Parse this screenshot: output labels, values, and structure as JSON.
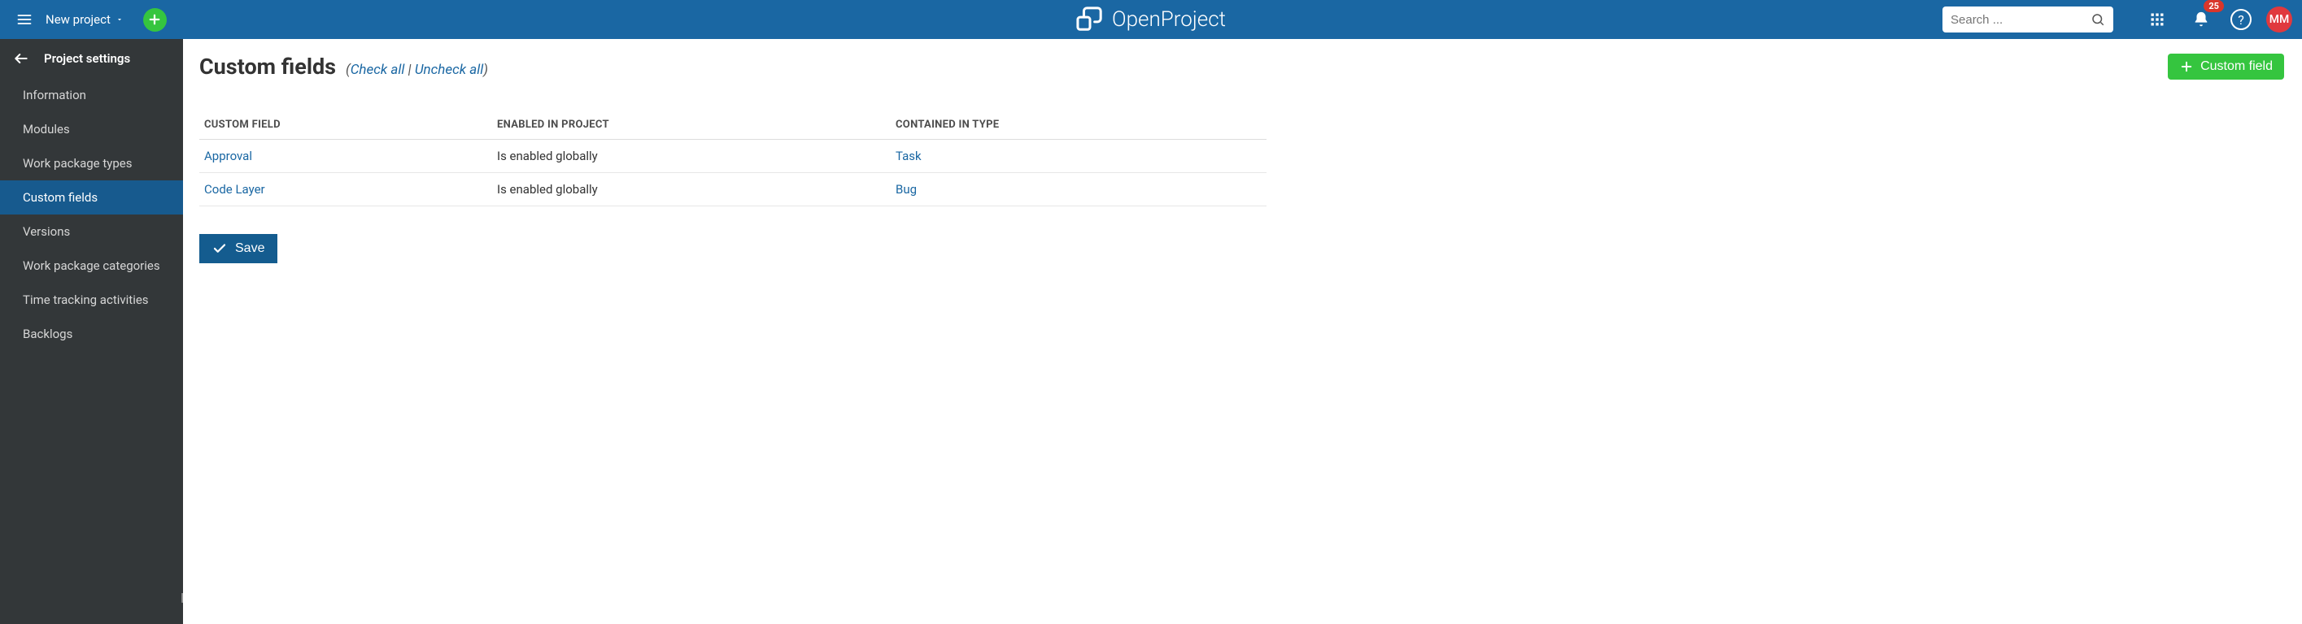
{
  "topbar": {
    "project_dropdown_label": "New project",
    "search_placeholder": "Search ...",
    "notification_count": "25",
    "avatar_initials": "MM",
    "brand_name": "OpenProject"
  },
  "sidebar": {
    "title": "Project settings",
    "items": [
      {
        "label": "Information",
        "active": false
      },
      {
        "label": "Modules",
        "active": false
      },
      {
        "label": "Work package types",
        "active": false
      },
      {
        "label": "Custom fields",
        "active": true
      },
      {
        "label": "Versions",
        "active": false
      },
      {
        "label": "Work package categories",
        "active": false
      },
      {
        "label": "Time tracking activities",
        "active": false
      },
      {
        "label": "Backlogs",
        "active": false
      }
    ]
  },
  "page": {
    "title": "Custom fields",
    "check_all": "Check all",
    "uncheck_all": "Uncheck all",
    "new_button_label": "Custom field",
    "save_button_label": "Save",
    "columns": {
      "name": "CUSTOM FIELD",
      "enabled": "ENABLED IN PROJECT",
      "types": "CONTAINED IN TYPE"
    },
    "rows": [
      {
        "name": "Approval",
        "enabled": "Is enabled globally",
        "type": "Task"
      },
      {
        "name": "Code Layer",
        "enabled": "Is enabled globally",
        "type": "Bug"
      }
    ]
  }
}
